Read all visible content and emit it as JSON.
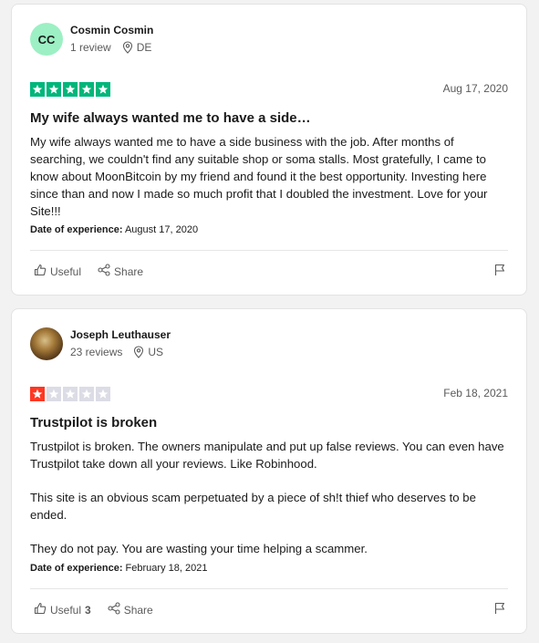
{
  "reviews": [
    {
      "avatar_initials": "CC",
      "name": "Cosmin Cosmin",
      "review_count": "1 review",
      "country": "DE",
      "rating": 5,
      "date": "Aug 17, 2020",
      "title": "My wife always wanted me to have a side…",
      "body": [
        "My wife always wanted me to have a side business with the job. After months of searching, we couldn't find any suitable shop or soma stalls. Most gratefully, I came to know about MoonBitcoin by my friend and found it the best opportunity. Investing here since than and now I made so much profit that I doubled the investment. Love for your Site!!!"
      ],
      "experience_label": "Date of experience:",
      "experience_date": "August 17, 2020",
      "useful_label": "Useful",
      "useful_count": "",
      "share_label": "Share"
    },
    {
      "avatar_initials": "",
      "name": "Joseph Leuthauser",
      "review_count": "23 reviews",
      "country": "US",
      "rating": 1,
      "date": "Feb 18, 2021",
      "title": "Trustpilot is broken",
      "body": [
        "Trustpilot is broken. The owners manipulate and put up false reviews. You can even have Trustpilot take down all your reviews. Like Robinhood.",
        "This site is an obvious scam perpetuated by a piece of sh!t thief who deserves to be ended.",
        "They do not pay. You are wasting your time helping a scammer."
      ],
      "experience_label": "Date of experience:",
      "experience_date": "February 18, 2021",
      "useful_label": "Useful",
      "useful_count": "3",
      "share_label": "Share"
    }
  ],
  "colors": {
    "five_star": "#00b67a",
    "one_star": "#ff3722",
    "empty_star": "#dcdce6",
    "avatar_initials_bg": "#9cf0c4"
  },
  "icons": [
    "location-pin-icon",
    "thumbs-up-icon",
    "share-icon",
    "flag-icon",
    "star-icon"
  ]
}
